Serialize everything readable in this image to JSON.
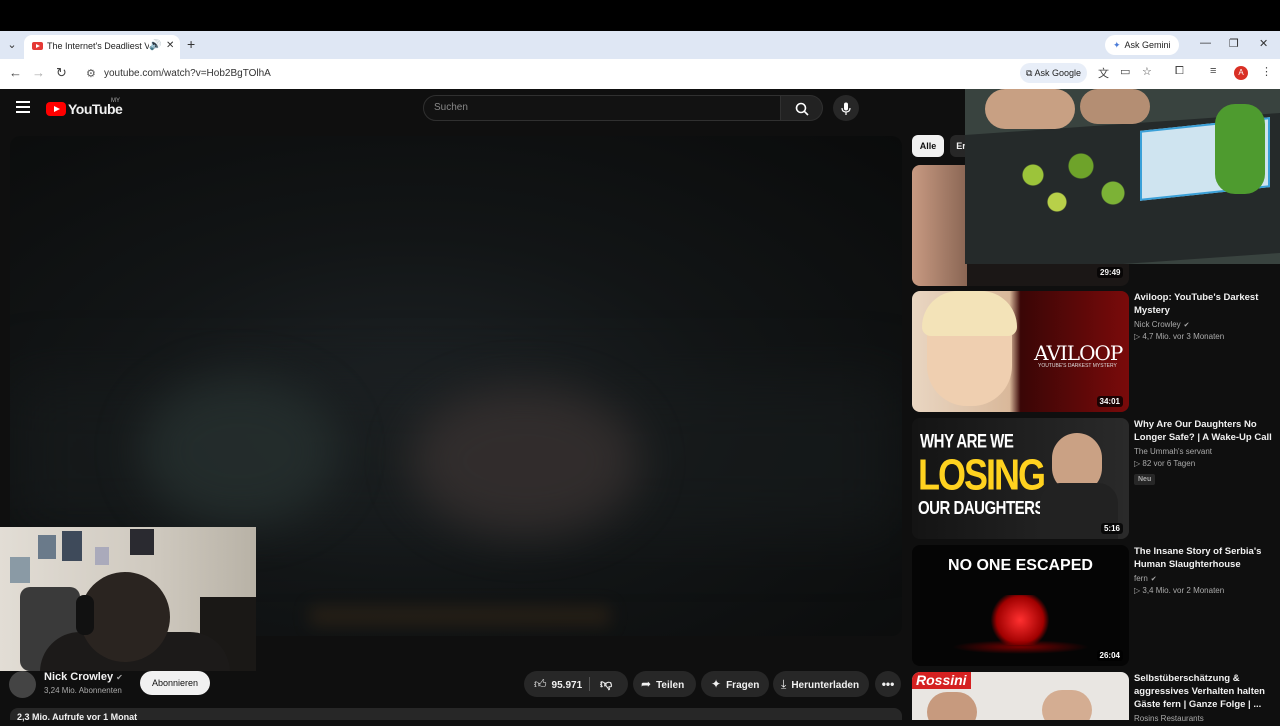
{
  "browser": {
    "tab_title": "The Internet's Deadliest Vid",
    "new_tab": "+",
    "ask_gemini": "Ask Gemini",
    "url": "youtube.com/watch?v=Hob2BgTOlhA",
    "ask_google": "Ask Google",
    "profile_initial": "A"
  },
  "youtube": {
    "logo_text": "YouTube",
    "country_code": "MY",
    "search_placeholder": "Suchen"
  },
  "video": {
    "channel_name": "Nick Crowley",
    "subscribers": "3,24 Mio. Abonnenten",
    "subscribe_label": "Abonnieren",
    "like_count": "95.971",
    "share_label": "Teilen",
    "ask_label": "Fragen",
    "download_label": "Herunterladen",
    "views_line": "2,3 Mio. Aufrufe  vor 1 Monat"
  },
  "chips": [
    {
      "label": "Alle"
    },
    {
      "label": "Er"
    }
  ],
  "recommendations": [
    {
      "duration": "29:49"
    },
    {
      "title": "Aviloop: YouTube's Darkest Mystery",
      "channel": "Nick Crowley",
      "stats": "▷ 4,7 Mio.  vor 3 Monaten",
      "duration": "34:01",
      "thumb_text": "AVILOOP",
      "thumb_subtext": "YOUTUBE'S DARKEST MYSTERY"
    },
    {
      "title": "Why Are Our Daughters No Longer Safe? | A Wake-Up Call",
      "channel": "The Ummah's servant",
      "stats": "▷ 82  vor 6 Tagen",
      "badge": "Neu",
      "duration": "5:16",
      "thumb_line1": "WHY ARE WE",
      "thumb_line2": "LOSING",
      "thumb_line3": "OUR DAUGHTERS?"
    },
    {
      "title": "The Insane Story of Serbia's Human Slaughterhouse",
      "channel": "fern",
      "stats": "▷ 3,4 Mio.  vor 2 Monaten",
      "duration": "26:04",
      "thumb_text": "NO ONE ESCAPED"
    },
    {
      "title": "Selbstüberschätzung & aggressives Verhalten halten Gäste fern | Ganze Folge | ...",
      "channel": "Rosins Restaurants",
      "thumb_text": "Rossini"
    }
  ],
  "colors": {
    "yt_red": "#ff0000",
    "bg": "#0f0f0f",
    "chip_active": "#f1f1f1",
    "aviloop_red": "#8a0a0a",
    "losing_yellow": "#ffd21f"
  }
}
